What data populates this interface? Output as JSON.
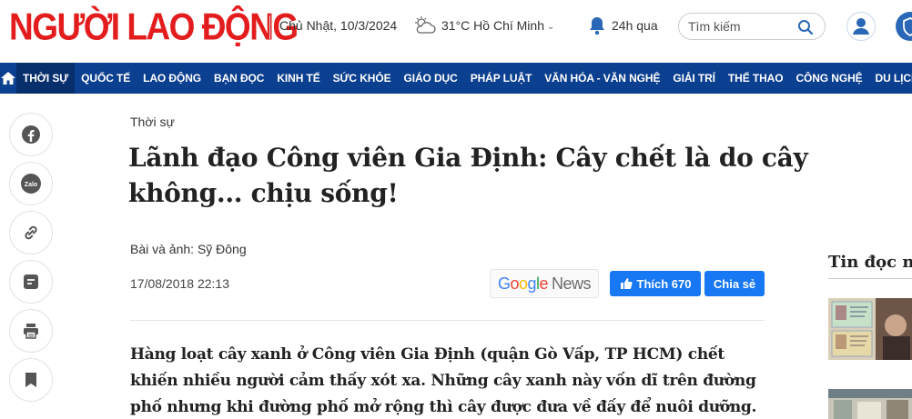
{
  "header": {
    "logo_text": "NGƯỜI LAO ĐỘNG",
    "date": "Chủ Nhật, 10/3/2024",
    "weather": "31°C Hồ Chí Minh",
    "notifications_label": "24h qua",
    "search_placeholder": "Tìm kiếm",
    "brand_color": "#e31d1d"
  },
  "nav": {
    "color": "#0b3f8f",
    "items": [
      "THỜI SỰ",
      "QUỐC TẾ",
      "LAO ĐỘNG",
      "BẠN ĐỌC",
      "KINH TẾ",
      "SỨC KHỎE",
      "GIÁO DỤC",
      "PHÁP LUẬT",
      "VĂN HÓA - VĂN NGHỆ",
      "GIẢI TRÍ",
      "THỂ THAO",
      "CÔNG NGHỆ",
      "DU LỊCH XANH"
    ]
  },
  "share_rail": {
    "icons": [
      "facebook-icon",
      "zalo-icon",
      "link-icon",
      "comment-icon",
      "print-icon",
      "bookmark-icon"
    ],
    "zalo_label": "Zalo"
  },
  "article": {
    "category": "Thời sự",
    "title": "Lãnh đạo Công viên Gia Định: Cây chết là do cây không... chịu sống!",
    "author": "Bài và ảnh: Sỹ Đông",
    "published": "17/08/2018 22:13",
    "google_news": {
      "g": "G",
      "o1": "o",
      "o2": "o",
      "g2": "g",
      "l": "l",
      "e": "e",
      "news": "News"
    },
    "like_label": "Thích 670",
    "share_label": "Chia sẻ",
    "lead": "Hàng loạt cây xanh ở Công viên Gia Định (quận Gò Vấp, TP HCM) chết khiến nhiều người cảm thấy xót xa. Những cây xanh này vốn dĩ trên đường phố nhưng khi đường phố mở rộng thì cây được đưa về đấy để nuôi dưỡng."
  },
  "sidebar": {
    "title": "Tin đọc nhiều"
  }
}
